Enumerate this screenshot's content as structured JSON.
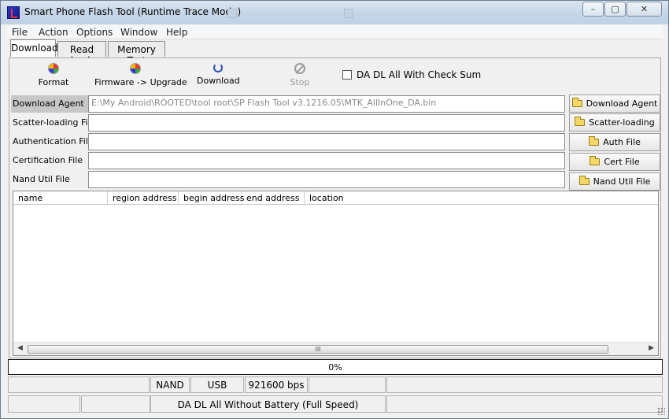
{
  "window": {
    "title": "Smart Phone Flash Tool (Runtime Trace Mode)",
    "minimize": "–",
    "maximize": "▢",
    "close": "✕"
  },
  "menu": [
    "File",
    "Action",
    "Options",
    "Window",
    "Help"
  ],
  "tabs": [
    {
      "label": "Download",
      "active": true
    },
    {
      "label": "Read back",
      "active": false
    },
    {
      "label": "Memory Test",
      "active": false
    }
  ],
  "toolbar": {
    "format": "Format",
    "firmware_upgrade": "Firmware -> Upgrade",
    "download": "Download",
    "stop": "Stop",
    "checksum_label": "DA DL All With Check Sum",
    "checksum_checked": false
  },
  "files": [
    {
      "label": "Download Agent",
      "value": "E:\\My Android\\ROOTED\\tool root\\SP Flash Tool v3.1216.05\\MTK_AllInOne_DA.bin",
      "button": "Download Agent"
    },
    {
      "label": "Scatter-loading File",
      "value": "",
      "button": "Scatter-loading"
    },
    {
      "label": "Authentication File",
      "value": "",
      "button": "Auth File"
    },
    {
      "label": "Certification File",
      "value": "",
      "button": "Cert File"
    },
    {
      "label": "Nand Util File",
      "value": "",
      "button": "Nand Util File"
    }
  ],
  "table": {
    "columns": [
      "name",
      "region address",
      "begin address",
      "end address",
      "location"
    ],
    "scroll_grip": "III"
  },
  "progress": {
    "percent": 0,
    "label": "0%"
  },
  "status": {
    "storage": "NAND",
    "port": "USB",
    "baud": "921600 bps",
    "mode": "DA DL All Without Battery (Full Speed)"
  },
  "colors": {
    "progress_fill": "#3aa64b",
    "highlight_label": "#c7c7c7"
  }
}
